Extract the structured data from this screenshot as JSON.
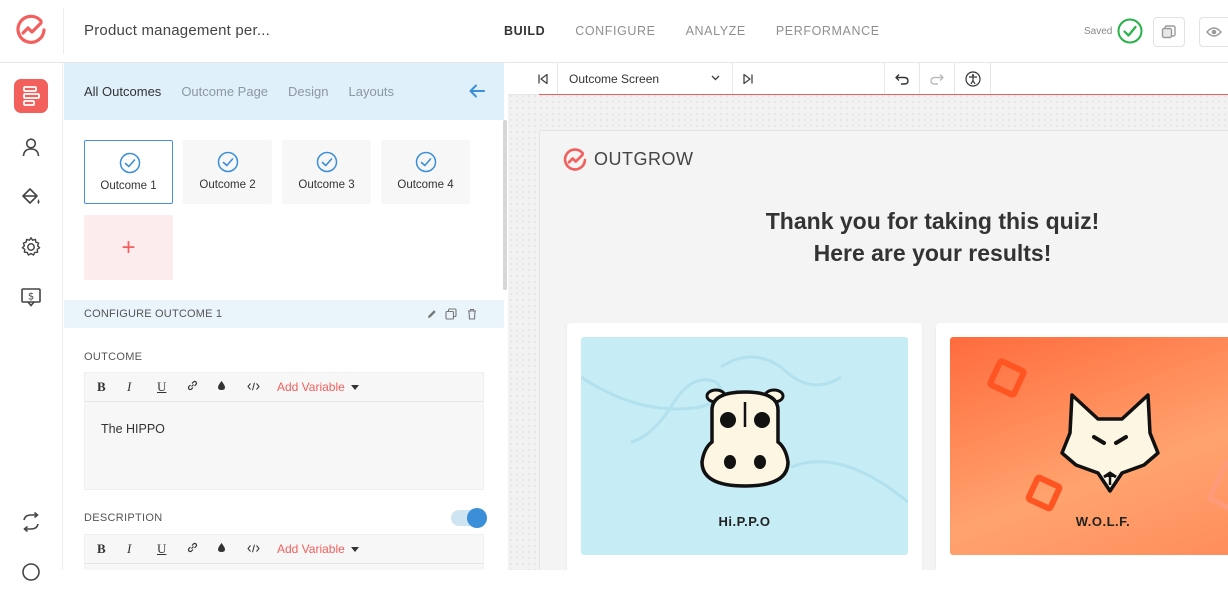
{
  "app": {
    "project_title": "Product management per...",
    "nav_tabs": [
      {
        "label": "BUILD",
        "active": true
      },
      {
        "label": "CONFIGURE",
        "active": false
      },
      {
        "label": "ANALYZE",
        "active": false
      },
      {
        "label": "PERFORMANCE",
        "active": false
      }
    ],
    "saved_label": "Saved",
    "brand_color": "#f25f5c",
    "accent_color": "#3a8fd8"
  },
  "rail": {
    "items": [
      {
        "name": "layout-icon",
        "active": true
      },
      {
        "name": "user-icon",
        "active": false
      },
      {
        "name": "paint-bucket-icon",
        "active": false
      },
      {
        "name": "gear-icon",
        "active": false
      },
      {
        "name": "dollar-screen-icon",
        "active": false
      },
      {
        "name": "refresh-icon",
        "active": false
      },
      {
        "name": "help-icon",
        "active": false
      }
    ]
  },
  "panel": {
    "tabs": [
      {
        "label": "All Outcomes",
        "active": true
      },
      {
        "label": "Outcome Page",
        "active": false
      },
      {
        "label": "Design",
        "active": false
      },
      {
        "label": "Layouts",
        "active": false
      }
    ],
    "outcomes": [
      {
        "label": "Outcome 1",
        "active": true
      },
      {
        "label": "Outcome 2",
        "active": false
      },
      {
        "label": "Outcome 3",
        "active": false
      },
      {
        "label": "Outcome 4",
        "active": false
      }
    ],
    "add_outcome_symbol": "+",
    "configure_title": "CONFIGURE OUTCOME 1",
    "outcome_field": {
      "label": "OUTCOME",
      "value": "The HIPPO"
    },
    "description_field": {
      "label": "DESCRIPTION",
      "enabled": true
    },
    "toolbar": {
      "bold": "B",
      "italic": "I",
      "underline": "U",
      "add_variable": "Add Variable"
    }
  },
  "canvas": {
    "screen_select_value": "Outcome Screen",
    "preview": {
      "brand": "OUTGROW",
      "heading_line1": "Thank you for taking this quiz!",
      "heading_line2": "Here are your results!",
      "results": [
        {
          "caption": "Hi.P.P.O",
          "bg": "#c6ecf6"
        },
        {
          "caption": "W.O.L.F.",
          "bg": "#ff8c5a"
        }
      ]
    }
  }
}
